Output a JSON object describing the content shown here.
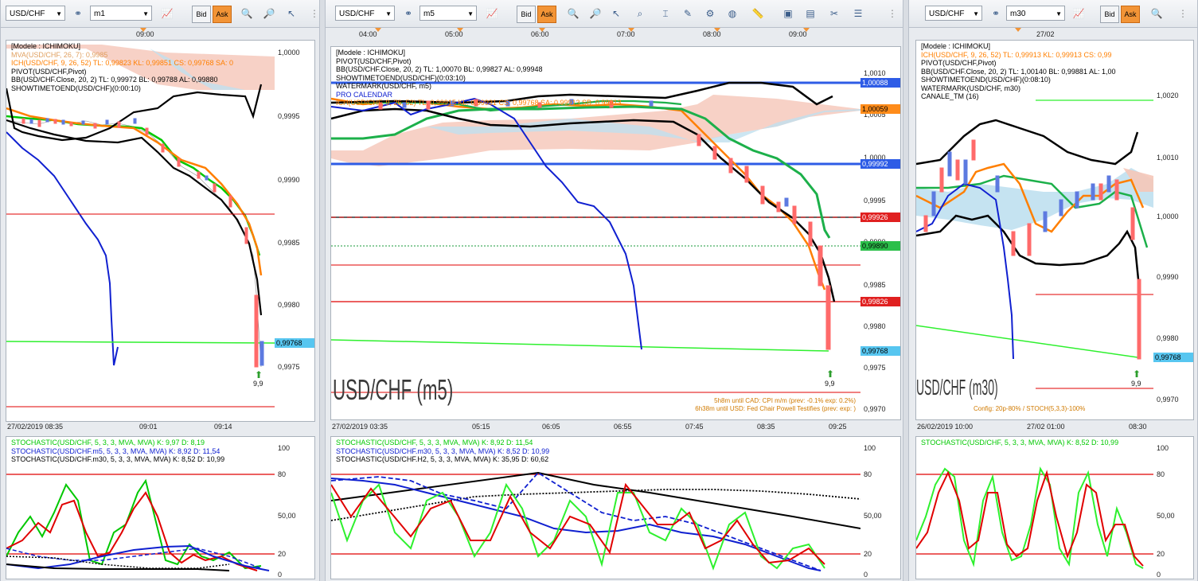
{
  "colors": {
    "accent": "#f29436",
    "green": "#00c800",
    "orange": "#ff7f00",
    "blue": "#1020d0",
    "black": "#000000",
    "red": "#e00000",
    "price_red": "#ff6a6a",
    "price_blue": "#5d7ae0",
    "axis_blue": "#57c6f0",
    "axis_red": "#e02020",
    "axis_orange": "#ff8c1a",
    "axis_green": "#2bbf4a",
    "cloud_red": "#f5c6b8",
    "cloud_blue": "#bfe0ef"
  },
  "panels": [
    {
      "id": "p1",
      "symbol": "USD/CHF",
      "timeframe": "m1",
      "bid": "Bid",
      "ask": "Ask",
      "top_time": "09:00",
      "legend": [
        {
          "text": "[Modele : ICHIMOKU]",
          "color": "#333333"
        },
        {
          "text": "MVA(USD/CHF, 26, 7): 0,9985",
          "color": "#e0a060"
        },
        {
          "text": "ICH(USD/CHF, 9, 26, 52)  TL: 0,99823  KL: 0,99851  CS: 0,99768  SA: 0",
          "color": "#ff7f00"
        },
        {
          "text": "PIVOT(USD/CHF,Pivot)",
          "color": "#000000"
        },
        {
          "text": "BB(USD/CHF.Close, 20, 2)  TL: 0,99972  BL: 0,99788  AL: 0,99880",
          "color": "#000000"
        },
        {
          "text": "SHOWTIMETOEND(USD/CHF)(0:00:10)",
          "color": "#000000"
        }
      ],
      "y_ticks": [
        "1,0000",
        "0,9995",
        "0,9990",
        "0,9985",
        "0,9980",
        "0,9975"
      ],
      "price_label": "0,99768",
      "x_ticks": [
        "27/02/2019 08:35",
        "09:01",
        "09:14"
      ],
      "arrow_value": "9,9",
      "osc_legend": [
        {
          "text": "STOCHASTIC(USD/CHF, 5, 3, 3, MVA, MVA)  K: 9,97  D: 8,19",
          "color": "#00c800"
        },
        {
          "text": "STOCHASTIC(USD/CHF.m5, 5, 3, 3, MVA, MVA)  K: 8,92  D: 11,54",
          "color": "#1020d0"
        },
        {
          "text": "STOCHASTIC(USD/CHF.m30, 5, 3, 3, MVA, MVA)  K: 8,52  D: 10,99",
          "color": "#000000"
        }
      ],
      "osc_ticks": [
        "100",
        "80",
        "50,00",
        "20",
        "0"
      ]
    },
    {
      "id": "p2",
      "symbol": "USD/CHF",
      "timeframe": "m5",
      "bid": "Bid",
      "ask": "Ask",
      "top_times": [
        "04:00",
        "05:00",
        "06:00",
        "07:00",
        "08:00",
        "09:00"
      ],
      "legend": [
        {
          "text": "[Modele : ICHIMOKU]",
          "color": "#333333"
        },
        {
          "text": "PIVOT(USD/CHF,Pivot)",
          "color": "#000000"
        },
        {
          "text": "BB(USD/CHF.Close, 20, 2)  TL: 1,00070  BL: 0,99827  AL: 0,99948",
          "color": "#000000"
        },
        {
          "text": "SHOWTIMETOEND(USD/CHF)(0:03:10)",
          "color": "#000000"
        },
        {
          "text": "WATERMARK(USD/CHF, m5)",
          "color": "#000000"
        },
        {
          "text": "PRO CALENDAR",
          "color": "#1020d0"
        },
        {
          "text": "ICH(USD/CHF, 9, 26, 52)  TL: 0,99915  KL: 0,99931  CS: 0,99768  SA: 0,99913  SB: 0,99913",
          "color": "#ff7f00"
        }
      ],
      "y_ticks": [
        "1,0010",
        "1,0005",
        "1,0000",
        "0,9995",
        "0,9990",
        "0,9985",
        "0,9980",
        "0,9975",
        "0,9970"
      ],
      "price_labels": [
        {
          "text": "1,00088",
          "bg": "#2e5ce6",
          "fg": "#ffffff"
        },
        {
          "text": "1,00059",
          "bg": "#ff8c1a",
          "fg": "#000000"
        },
        {
          "text": "0,99992",
          "bg": "#2e5ce6",
          "fg": "#ffffff"
        },
        {
          "text": "0,99926",
          "bg": "#e02020",
          "fg": "#ffffff"
        },
        {
          "text": "0,99890",
          "bg": "#2bbf4a",
          "fg": "#000000"
        },
        {
          "text": "0,99826",
          "bg": "#e02020",
          "fg": "#ffffff"
        },
        {
          "text": "0,99768",
          "bg": "#57c6f0",
          "fg": "#000000"
        }
      ],
      "watermark": "USD/CHF (m5)",
      "footnotes": [
        "5h8m until CAD: CPI m/m (prev: -0.1% exp: 0.2%)",
        "6h38m until USD: Fed Chair Powell Testifies (prev:  exp: )"
      ],
      "x_ticks": [
        "27/02/2019 03:35",
        "05:15",
        "06:05",
        "06:55",
        "07:45",
        "08:35",
        "09:25"
      ],
      "arrow_value": "9,9",
      "osc_legend": [
        {
          "text": "STOCHASTIC(USD/CHF, 5, 3, 3, MVA, MVA)  K: 8,92  D: 11,54",
          "color": "#00c800"
        },
        {
          "text": "STOCHASTIC(USD/CHF.m30, 5, 3, 3, MVA, MVA)  K: 8,52  D: 10,99",
          "color": "#1020d0"
        },
        {
          "text": "STOCHASTIC(USD/CHF.H2, 5, 3, 3, MVA, MVA)  K: 35,95  D: 60,62",
          "color": "#000000"
        }
      ],
      "osc_ticks": [
        "100",
        "80",
        "50,00",
        "20",
        "0"
      ]
    },
    {
      "id": "p3",
      "symbol": "USD/CHF",
      "timeframe": "m30",
      "bid": "Bid",
      "ask": "Ask",
      "top_time": "27/02",
      "legend": [
        {
          "text": "[Modele : ICHIMOKU]",
          "color": "#333333"
        },
        {
          "text": "ICH(USD/CHF, 9, 26, 52)  TL: 0,99913  KL: 0,99913  CS: 0,99",
          "color": "#ff7f00"
        },
        {
          "text": "PIVOT(USD/CHF,Pivot)",
          "color": "#000000"
        },
        {
          "text": "BB(USD/CHF.Close, 20, 2)  TL: 1,00140  BL: 0,99881  AL: 1,00",
          "color": "#000000"
        },
        {
          "text": "SHOWTIMETOEND(USD/CHF)(0:08:10)",
          "color": "#000000"
        },
        {
          "text": "WATERMARK(USD/CHF, m30)",
          "color": "#000000"
        },
        {
          "text": "CANALE_TM (16)",
          "color": "#000000"
        }
      ],
      "y_ticks": [
        "1,0020",
        "1,0010",
        "1,0000",
        "0,9990",
        "0,9980",
        "0,9970"
      ],
      "price_label": "0,99768",
      "watermark": "USD/CHF (m30)",
      "footnote": "Config: 20p-80% / STOCH(5,3,3)-100%",
      "x_ticks": [
        "26/02/2019 10:00",
        "27/02 01:00",
        "08:30"
      ],
      "arrow_value": "9,9",
      "osc_legend": [
        {
          "text": "STOCHASTIC(USD/CHF, 5, 3, 3, MVA, MVA)  K: 8,52  D: 10,99",
          "color": "#00c800"
        }
      ],
      "osc_ticks": [
        "100",
        "80",
        "50,00",
        "20",
        "0"
      ]
    }
  ],
  "icons": [
    "link-icon",
    "chart-type-icon",
    "zoom-in-icon",
    "zoom-out-icon",
    "cursor-icon",
    "indicator-icon",
    "text-icon",
    "drawing-icon",
    "settings-icon",
    "globe-icon",
    "ruler-icon",
    "image-icon",
    "template-icon",
    "tools-icon",
    "menu-icon"
  ]
}
